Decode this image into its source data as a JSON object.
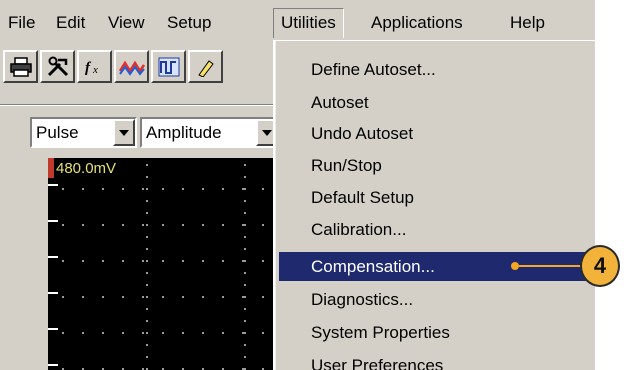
{
  "menubar": {
    "items": [
      "File",
      "Edit",
      "View",
      "Setup",
      "Utilities",
      "Applications",
      "Help"
    ]
  },
  "toolbar": {
    "buttons": [
      "print-icon",
      "tools-icon",
      "fx-icon",
      "waveform-icon",
      "measure-icon",
      "cursor-icon"
    ]
  },
  "selectors": {
    "source_value": "Pulse",
    "measurement_value": "Amplitude"
  },
  "scope": {
    "scale_label": "480.0mV"
  },
  "utilities_menu": {
    "items": [
      "Define Autoset...",
      "Autoset",
      "Undo Autoset",
      "Run/Stop",
      "Default Setup",
      "Calibration...",
      "Compensation...",
      "Diagnostics...",
      "System Properties",
      "User Preferences"
    ],
    "highlighted_index": 6
  },
  "callout": {
    "number": "4"
  },
  "colors": {
    "menu_highlight": "#1f2a6e",
    "callout": "#f3b23a",
    "scale_text": "#e6e070"
  }
}
